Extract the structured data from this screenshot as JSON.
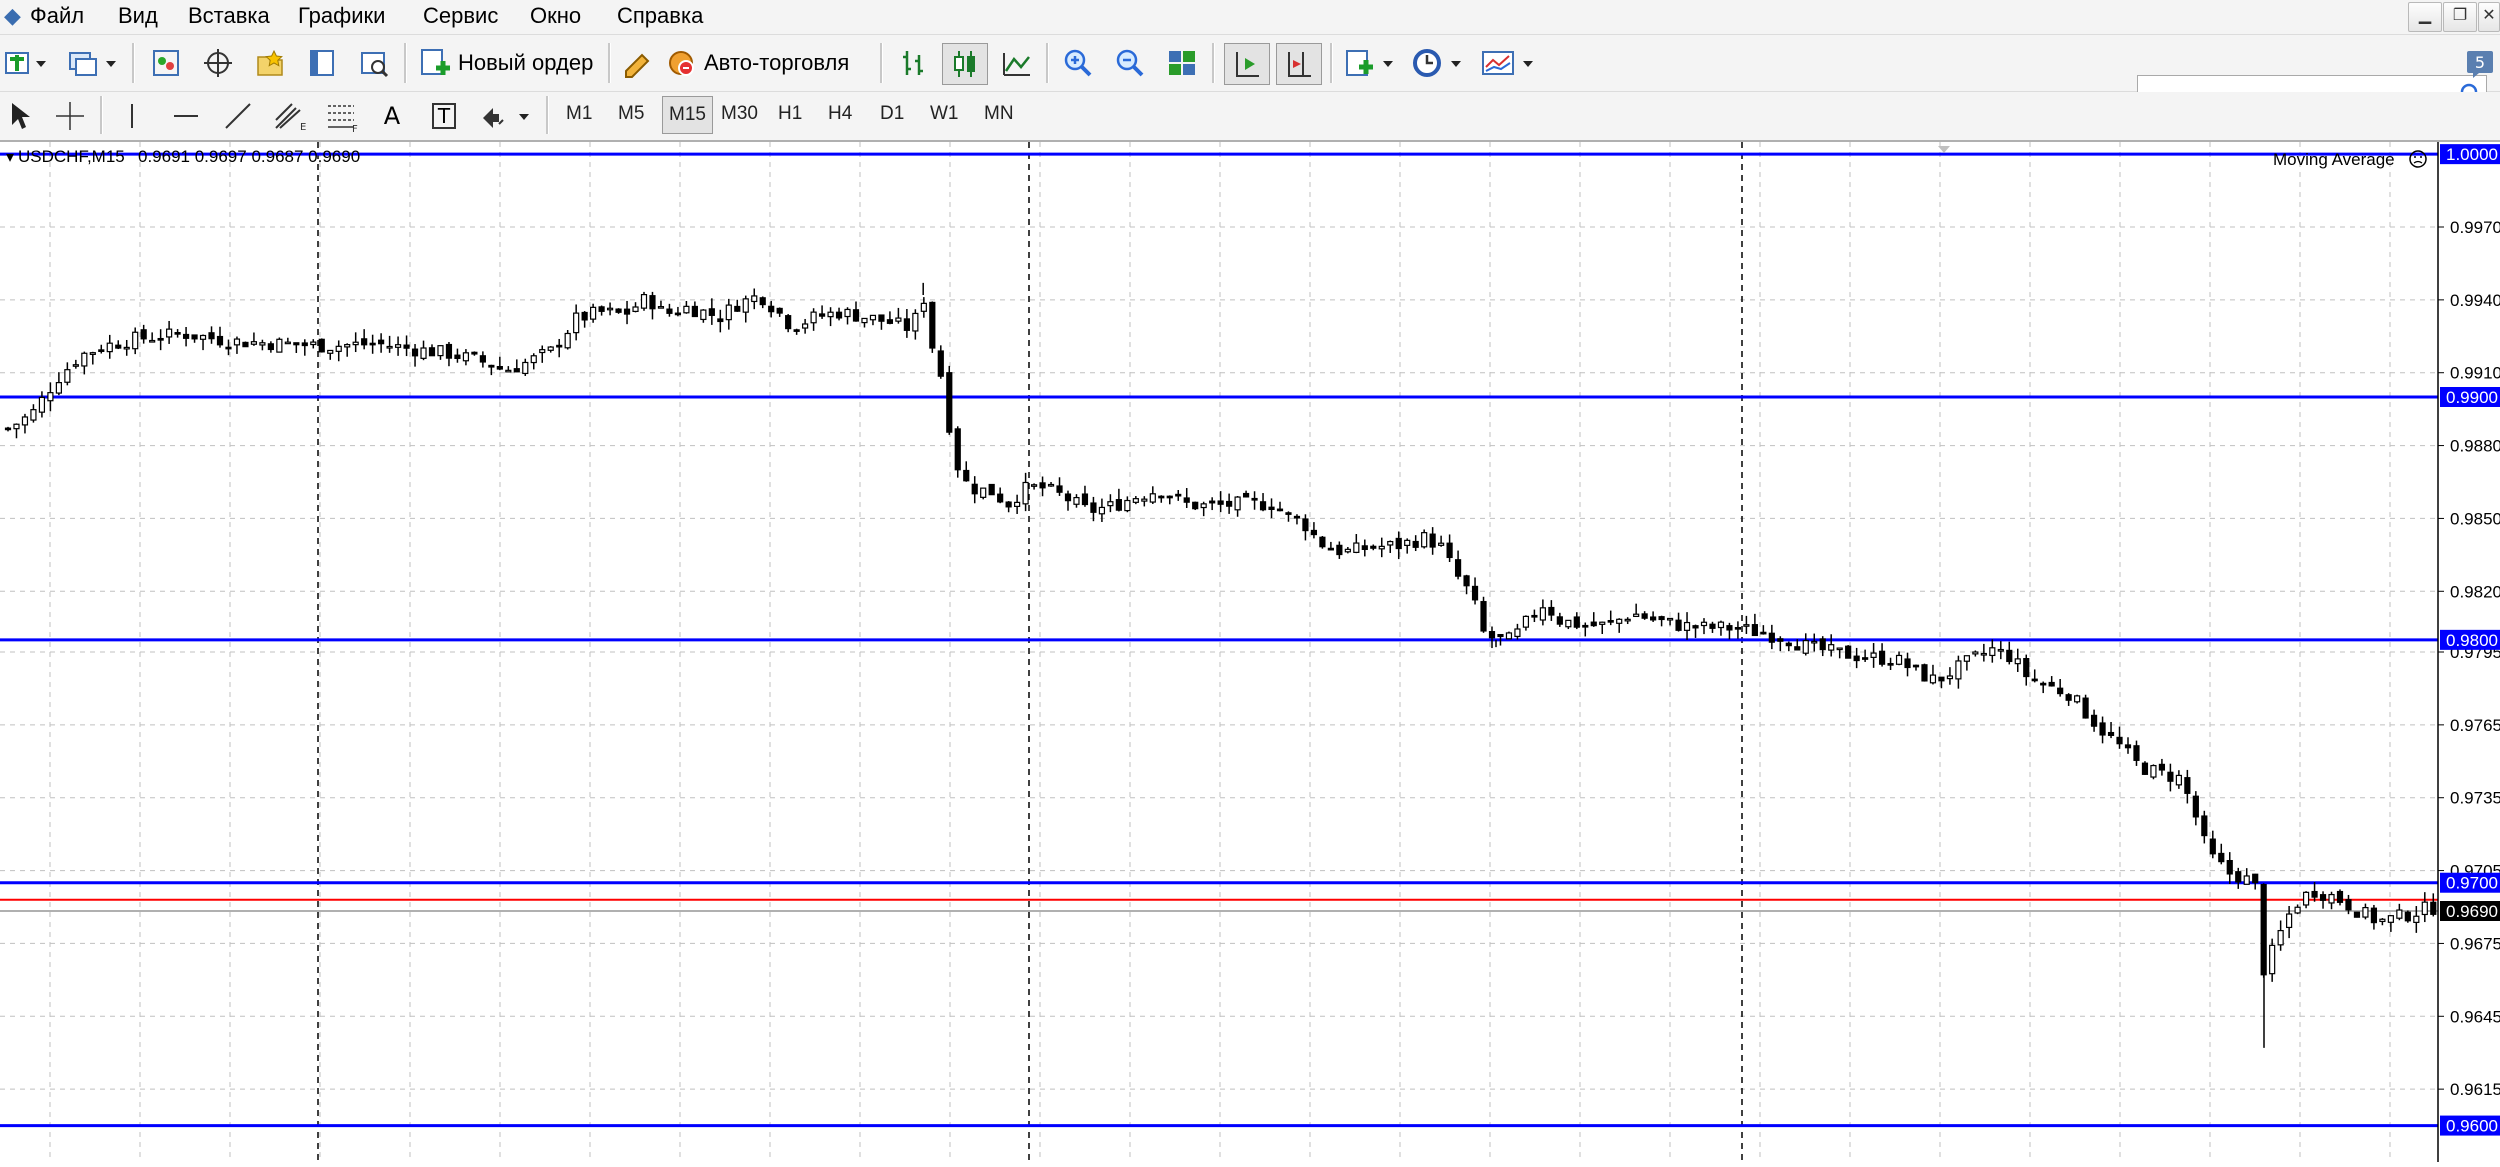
{
  "menu": {
    "items": [
      "Файл",
      "Вид",
      "Вставка",
      "Графики",
      "Сервис",
      "Окно",
      "Справка"
    ]
  },
  "window_controls": [
    "minimize",
    "restore",
    "close"
  ],
  "toolbar": {
    "new_order_label": "Новый ордер",
    "autotrade_label": "Авто-торговля",
    "search_placeholder": "",
    "icons": [
      "new-chart-icon",
      "profiles-icon",
      "market-watch-icon",
      "navigator-icon",
      "favorites-icon",
      "data-window-icon",
      "strategy-tester-icon",
      "new-order-icon",
      "meta-editor-icon",
      "autotrading-icon",
      "bar-chart-icon",
      "candlestick-icon",
      "line-chart-icon",
      "zoom-in-icon",
      "zoom-out-icon",
      "tile-windows-icon",
      "auto-scroll-icon",
      "chart-shift-icon",
      "indicators-icon",
      "periods-icon",
      "templates-icon",
      "search-icon",
      "notifications-icon"
    ]
  },
  "drawing_tools": {
    "icons": [
      "cursor-icon",
      "crosshair-icon",
      "vertical-line-icon",
      "horizontal-line-icon",
      "trendline-icon",
      "equidistant-channel-icon",
      "fibonacci-icon",
      "text-icon",
      "text-label-icon",
      "arrows-icon"
    ],
    "text_tool_glyph": "A",
    "label_tool_glyph": "T"
  },
  "timeframes": {
    "items": [
      "M1",
      "M5",
      "M15",
      "M30",
      "H1",
      "H4",
      "D1",
      "W1",
      "MN"
    ],
    "active": "M15"
  },
  "chart_header": {
    "symbol_info": "USDCHF,M15",
    "ohlc": "0.9691 0.9697 0.9687 0.9690",
    "indicator_label": "Moving Average"
  },
  "colors": {
    "level_line": "#0000ff",
    "bid_line": "#ff0000",
    "ask_line": "#b0b0b0",
    "candle": "#000000",
    "grid": "#c0c0c0",
    "price_badge_level": "#0000ff",
    "price_badge_current": "#000000"
  },
  "chart_data": {
    "type": "candlestick",
    "symbol": "USDCHF",
    "timeframe": "M15",
    "ylim": [
      0.9585,
      1.0005
    ],
    "price_ticks": [
      "0.9970",
      "0.9940",
      "0.9910",
      "0.9880",
      "0.9850",
      "0.9820",
      "0.9795",
      "0.9765",
      "0.9735",
      "0.9705",
      "0.9675",
      "0.9645",
      "0.9615"
    ],
    "levels": [
      1.0,
      0.99,
      0.98,
      0.97,
      0.96
    ],
    "level_labels": [
      "1.0000",
      "0.9900",
      "0.9800",
      "0.9700",
      "0.9600"
    ],
    "current_price": 0.969,
    "current_price_label": "0.9690",
    "bid_line": 0.9693,
    "close_path": [
      [
        0,
        0.9887
      ],
      [
        15,
        0.9893
      ],
      [
        30,
        0.9907
      ],
      [
        45,
        0.9917
      ],
      [
        60,
        0.9921
      ],
      [
        80,
        0.9924
      ],
      [
        110,
        0.9926
      ],
      [
        140,
        0.9923
      ],
      [
        170,
        0.9922
      ],
      [
        200,
        0.9921
      ],
      [
        230,
        0.9922
      ],
      [
        250,
        0.992
      ],
      [
        275,
        0.9918
      ],
      [
        300,
        0.9914
      ],
      [
        310,
        0.9911
      ],
      [
        320,
        0.9913
      ],
      [
        340,
        0.9919
      ],
      [
        355,
        0.9932
      ],
      [
        370,
        0.9935
      ],
      [
        385,
        0.9934
      ],
      [
        400,
        0.9941
      ],
      [
        410,
        0.9934
      ],
      [
        425,
        0.9937
      ],
      [
        445,
        0.9933
      ],
      [
        455,
        0.9938
      ],
      [
        470,
        0.9942
      ],
      [
        480,
        0.9936
      ],
      [
        490,
        0.9929
      ],
      [
        505,
        0.9933
      ],
      [
        520,
        0.9935
      ],
      [
        535,
        0.9933
      ],
      [
        550,
        0.9931
      ],
      [
        565,
        0.9928
      ],
      [
        572,
        0.9942
      ],
      [
        578,
        0.992
      ],
      [
        585,
        0.9905
      ],
      [
        590,
        0.988
      ],
      [
        596,
        0.9866
      ],
      [
        605,
        0.9862
      ],
      [
        615,
        0.9861
      ],
      [
        625,
        0.9856
      ],
      [
        635,
        0.9862
      ],
      [
        645,
        0.9863
      ],
      [
        660,
        0.9859
      ],
      [
        675,
        0.9853
      ],
      [
        690,
        0.9855
      ],
      [
        705,
        0.9859
      ],
      [
        720,
        0.9862
      ],
      [
        735,
        0.9856
      ],
      [
        750,
        0.9855
      ],
      [
        770,
        0.9856
      ],
      [
        790,
        0.9856
      ],
      [
        800,
        0.9851
      ],
      [
        810,
        0.9848
      ],
      [
        820,
        0.984
      ],
      [
        835,
        0.9836
      ],
      [
        850,
        0.9838
      ],
      [
        870,
        0.9839
      ],
      [
        885,
        0.9842
      ],
      [
        895,
        0.9839
      ],
      [
        905,
        0.9827
      ],
      [
        915,
        0.9818
      ],
      [
        922,
        0.9803
      ],
      [
        930,
        0.98
      ],
      [
        940,
        0.98
      ],
      [
        950,
        0.9808
      ],
      [
        960,
        0.9815
      ],
      [
        970,
        0.9808
      ],
      [
        985,
        0.9806
      ],
      [
        1000,
        0.9806
      ],
      [
        1015,
        0.9811
      ],
      [
        1030,
        0.9808
      ],
      [
        1045,
        0.9806
      ],
      [
        1060,
        0.9805
      ],
      [
        1080,
        0.9805
      ],
      [
        1095,
        0.9803
      ],
      [
        1110,
        0.9801
      ],
      [
        1125,
        0.9797
      ],
      [
        1140,
        0.9795
      ],
      [
        1160,
        0.9793
      ],
      [
        1180,
        0.9792
      ],
      [
        1195,
        0.9786
      ],
      [
        1205,
        0.9783
      ],
      [
        1215,
        0.9787
      ],
      [
        1228,
        0.9792
      ],
      [
        1240,
        0.9796
      ],
      [
        1252,
        0.9793
      ],
      [
        1262,
        0.9785
      ],
      [
        1275,
        0.9781
      ],
      [
        1288,
        0.9778
      ],
      [
        1300,
        0.9769
      ],
      [
        1310,
        0.9762
      ],
      [
        1322,
        0.9755
      ],
      [
        1332,
        0.9748
      ],
      [
        1345,
        0.9745
      ],
      [
        1358,
        0.9743
      ],
      [
        1366,
        0.973
      ],
      [
        1375,
        0.9712
      ],
      [
        1388,
        0.9704
      ],
      [
        1398,
        0.9702
      ],
      [
        1405,
        0.9698
      ],
      [
        1410,
        0.9663
      ],
      [
        1418,
        0.9676
      ],
      [
        1428,
        0.969
      ],
      [
        1440,
        0.9697
      ],
      [
        1455,
        0.9694
      ],
      [
        1470,
        0.9688
      ],
      [
        1482,
        0.9684
      ],
      [
        1495,
        0.9686
      ],
      [
        1510,
        0.9689
      ],
      [
        1517,
        0.969
      ]
    ],
    "spikes": [
      [
        572,
        0.9947
      ],
      [
        1410,
        0.9632
      ],
      [
        930,
        0.9797
      ]
    ]
  }
}
